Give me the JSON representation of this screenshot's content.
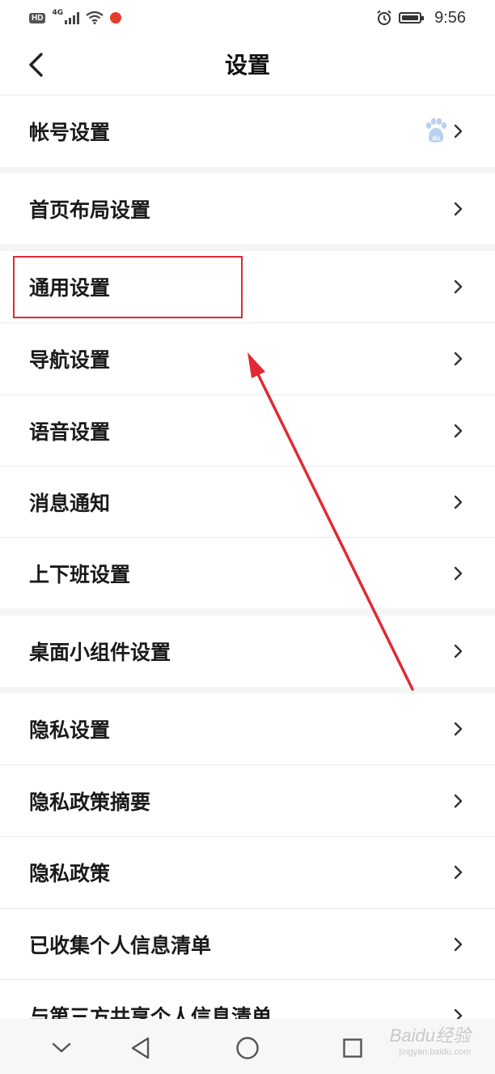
{
  "status_bar": {
    "left_icons": [
      "hd-badge",
      "4g-signal-icon",
      "wifi-icon",
      "app-notification-icon"
    ],
    "hd_label": "HD",
    "network_label": "4G",
    "right_icons": [
      "alarm-icon",
      "battery-icon"
    ],
    "time": "9:56"
  },
  "header": {
    "title": "设置",
    "back_icon": "chevron-left-icon"
  },
  "settings": {
    "items": [
      {
        "label": "帐号设置",
        "extra_icon": "baidu-paw-icon"
      },
      {
        "label": "首页布局设置"
      },
      {
        "label": "通用设置"
      },
      {
        "label": "导航设置"
      },
      {
        "label": "语音设置"
      },
      {
        "label": "消息通知"
      },
      {
        "label": "上下班设置"
      },
      {
        "label": "桌面小组件设置"
      },
      {
        "label": "隐私设置"
      },
      {
        "label": "隐私政策摘要"
      },
      {
        "label": "隐私政策"
      },
      {
        "label": "已收集个人信息清单"
      },
      {
        "label": "与第三方共享个人信息清单"
      }
    ]
  },
  "annotation": {
    "highlight_color": "#e02a33",
    "arrow_color": "#e02a33"
  },
  "nav_bar": {
    "buttons": [
      "hide-keyboard-chevron-icon",
      "back-triangle-icon",
      "home-circle-icon",
      "recents-square-icon"
    ]
  },
  "watermark": {
    "text": "Baidu经验",
    "sub": "jingyan.baidu.com"
  }
}
